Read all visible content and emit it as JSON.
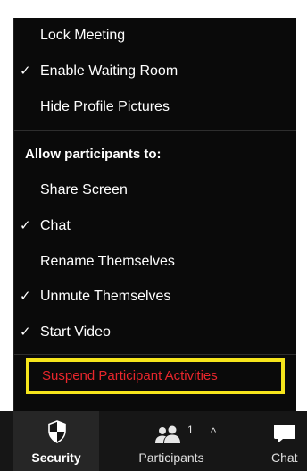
{
  "menu": {
    "items_top": [
      {
        "label": "Lock Meeting",
        "checked": false
      },
      {
        "label": "Enable Waiting Room",
        "checked": true
      },
      {
        "label": "Hide Profile Pictures",
        "checked": false
      }
    ],
    "section_header": "Allow participants to:",
    "items_allow": [
      {
        "label": "Share Screen",
        "checked": false
      },
      {
        "label": "Chat",
        "checked": true
      },
      {
        "label": "Rename Themselves",
        "checked": false
      },
      {
        "label": "Unmute Themselves",
        "checked": true
      },
      {
        "label": "Start Video",
        "checked": true
      }
    ],
    "suspend_label": "Suspend Participant Activities",
    "check_glyph": "✓"
  },
  "toolbar": {
    "security_label": "Security",
    "participants_label": "Participants",
    "participants_count": "1",
    "caret_glyph": "^",
    "chat_label": "Chat"
  },
  "colors": {
    "menu_bg": "#0a0a0a",
    "suspend_text": "#e8262c",
    "highlight_box": "#f6e51c",
    "toolbar_bg": "#161616"
  },
  "icons": {
    "security": "shield-icon",
    "participants": "participants-icon",
    "caret": "caret-up-icon",
    "chat": "chat-bubble-icon"
  }
}
